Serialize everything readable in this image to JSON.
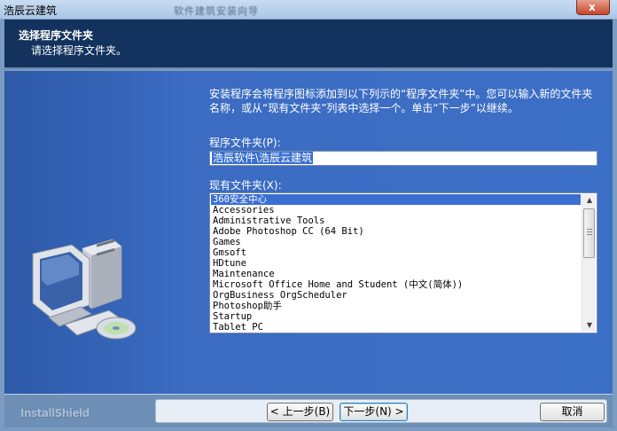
{
  "window": {
    "title": "浩辰云建筑",
    "obscured_title": "软件建筑安装向导",
    "close_label": "x"
  },
  "header": {
    "title": "选择程序文件夹",
    "subtitle": "请选择程序文件夹。"
  },
  "description": "安装程序会将程序图标添加到以下列示的“程序文件夹”中。您可以输入新的文件夹名称，或从“现有文件夹”列表中选择一个。单击“下一步”以继续。",
  "program_folder": {
    "label": "程序文件夹(P):",
    "value": "浩辰软件\\浩辰云建筑"
  },
  "existing_folders": {
    "label": "现有文件夹(X):",
    "items": [
      "360安全中心",
      "Accessories",
      "Administrative Tools",
      "Adobe Photoshop CC (64 Bit)",
      "Games",
      "Gmsoft",
      "HDtune",
      "Maintenance",
      "Microsoft Office Home and Student (中文(简体))",
      "OrgBusiness OrgScheduler",
      "Photoshop助手",
      "Startup",
      "Tablet PC"
    ],
    "selected_index": 0
  },
  "footer": {
    "brand": "InstallShield",
    "back_label": "< 上一步(B)",
    "next_label": "下一步(N) >",
    "cancel_label": "取消"
  },
  "icons": {
    "computer": "computer-cd-icon",
    "scroll_up": "scroll-up-icon",
    "scroll_down": "scroll-down-icon"
  }
}
